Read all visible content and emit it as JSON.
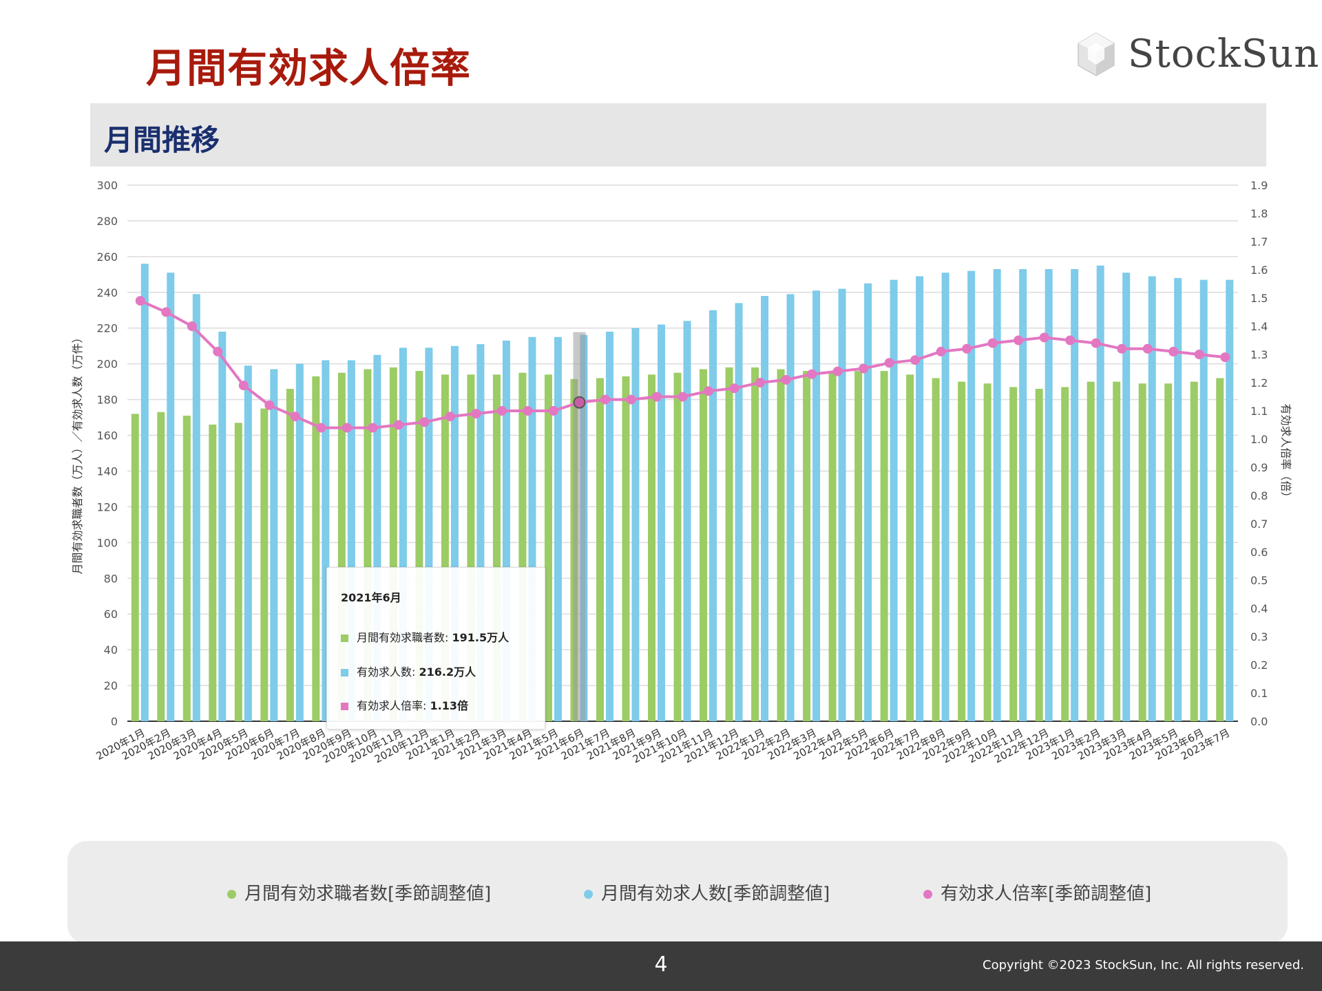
{
  "page": {
    "title": "月間有効求人倍率",
    "logo_text": "StockSun",
    "section_title": "月間推移",
    "page_number": "4",
    "copyright": "Copyright ©2023 StockSun, Inc. All rights reserved."
  },
  "tooltip": {
    "title": "2021年6月",
    "rows": [
      {
        "label": "月間有効求職者数: ",
        "value": "191.5万人",
        "color": "#9ccc65"
      },
      {
        "label": "有効求人数: ",
        "value": "216.2万人",
        "color": "#7ecbea"
      },
      {
        "label": "有効求人倍率: ",
        "value": "1.13倍",
        "color": "#e377c2"
      }
    ]
  },
  "colors": {
    "seekers": "#9ccc65",
    "openings": "#7ecbea",
    "ratio": "#e377c2",
    "title_red": "#a81b0c",
    "section_navy": "#1a2f6e"
  },
  "chart_data": {
    "type": "bar",
    "combo": "bar+line",
    "ylabel_left": "月間有効求職者数（万人）／有効求人数（万件）",
    "ylabel_right": "有効求人倍率（倍）",
    "ylim_left": [
      0,
      300
    ],
    "ylim_right": [
      0,
      1.9
    ],
    "yticks_left": [
      "0",
      "20",
      "40",
      "60",
      "80",
      "100",
      "120",
      "140",
      "160",
      "180",
      "200",
      "220",
      "240",
      "260",
      "280",
      "300"
    ],
    "yticks_right": [
      "0.0",
      "0.1",
      "0.2",
      "0.3",
      "0.4",
      "0.5",
      "0.6",
      "0.7",
      "0.8",
      "0.9",
      "1.0",
      "1.1",
      "1.2",
      "1.3",
      "1.4",
      "1.5",
      "1.6",
      "1.7",
      "1.8",
      "1.9"
    ],
    "categories": [
      "2020年1月",
      "2020年2月",
      "2020年3月",
      "2020年4月",
      "2020年5月",
      "2020年6月",
      "2020年7月",
      "2020年8月",
      "2020年9月",
      "2020年10月",
      "2020年11月",
      "2020年12月",
      "2021年1月",
      "2021年2月",
      "2021年3月",
      "2021年4月",
      "2021年5月",
      "2021年6月",
      "2021年7月",
      "2021年8月",
      "2021年9月",
      "2021年10月",
      "2021年11月",
      "2021年12月",
      "2022年1月",
      "2022年2月",
      "2022年3月",
      "2022年4月",
      "2022年5月",
      "2022年6月",
      "2022年7月",
      "2022年8月",
      "2022年9月",
      "2022年10月",
      "2022年11月",
      "2022年12月",
      "2023年1月",
      "2023年2月",
      "2023年3月",
      "2023年4月",
      "2023年5月",
      "2023年6月",
      "2023年7月"
    ],
    "highlight_index": 17,
    "grid": true,
    "legend_position": "bottom",
    "series": [
      {
        "name": "月間有効求職者数[季節調整値]",
        "kind": "bar",
        "axis": "left",
        "values": [
          172,
          173,
          171,
          166,
          167,
          175,
          186,
          193,
          195,
          197,
          198,
          196,
          194,
          194,
          194,
          195,
          194,
          191.5,
          192,
          193,
          194,
          195,
          197,
          198,
          198,
          197,
          196,
          196,
          196,
          196,
          194,
          192,
          190,
          189,
          187,
          186,
          187,
          190,
          190,
          189,
          189,
          190,
          192
        ]
      },
      {
        "name": "月間有効求人数[季節調整値]",
        "kind": "bar",
        "axis": "left",
        "values": [
          256,
          251,
          239,
          218,
          199,
          197,
          200,
          202,
          202,
          205,
          209,
          209,
          210,
          211,
          213,
          215,
          215,
          216.2,
          218,
          220,
          222,
          224,
          230,
          234,
          238,
          239,
          241,
          242,
          245,
          247,
          249,
          251,
          252,
          253,
          253,
          253,
          253,
          255,
          251,
          249,
          248,
          247,
          247
        ]
      },
      {
        "name": "有効求人倍率[季節調整値]",
        "kind": "line",
        "axis": "right",
        "values": [
          1.49,
          1.45,
          1.4,
          1.31,
          1.19,
          1.12,
          1.08,
          1.04,
          1.04,
          1.04,
          1.05,
          1.06,
          1.08,
          1.09,
          1.1,
          1.1,
          1.1,
          1.13,
          1.14,
          1.14,
          1.15,
          1.15,
          1.17,
          1.18,
          1.2,
          1.21,
          1.23,
          1.24,
          1.25,
          1.27,
          1.28,
          1.31,
          1.32,
          1.34,
          1.35,
          1.36,
          1.35,
          1.34,
          1.32,
          1.32,
          1.31,
          1.3,
          1.29
        ]
      }
    ]
  }
}
